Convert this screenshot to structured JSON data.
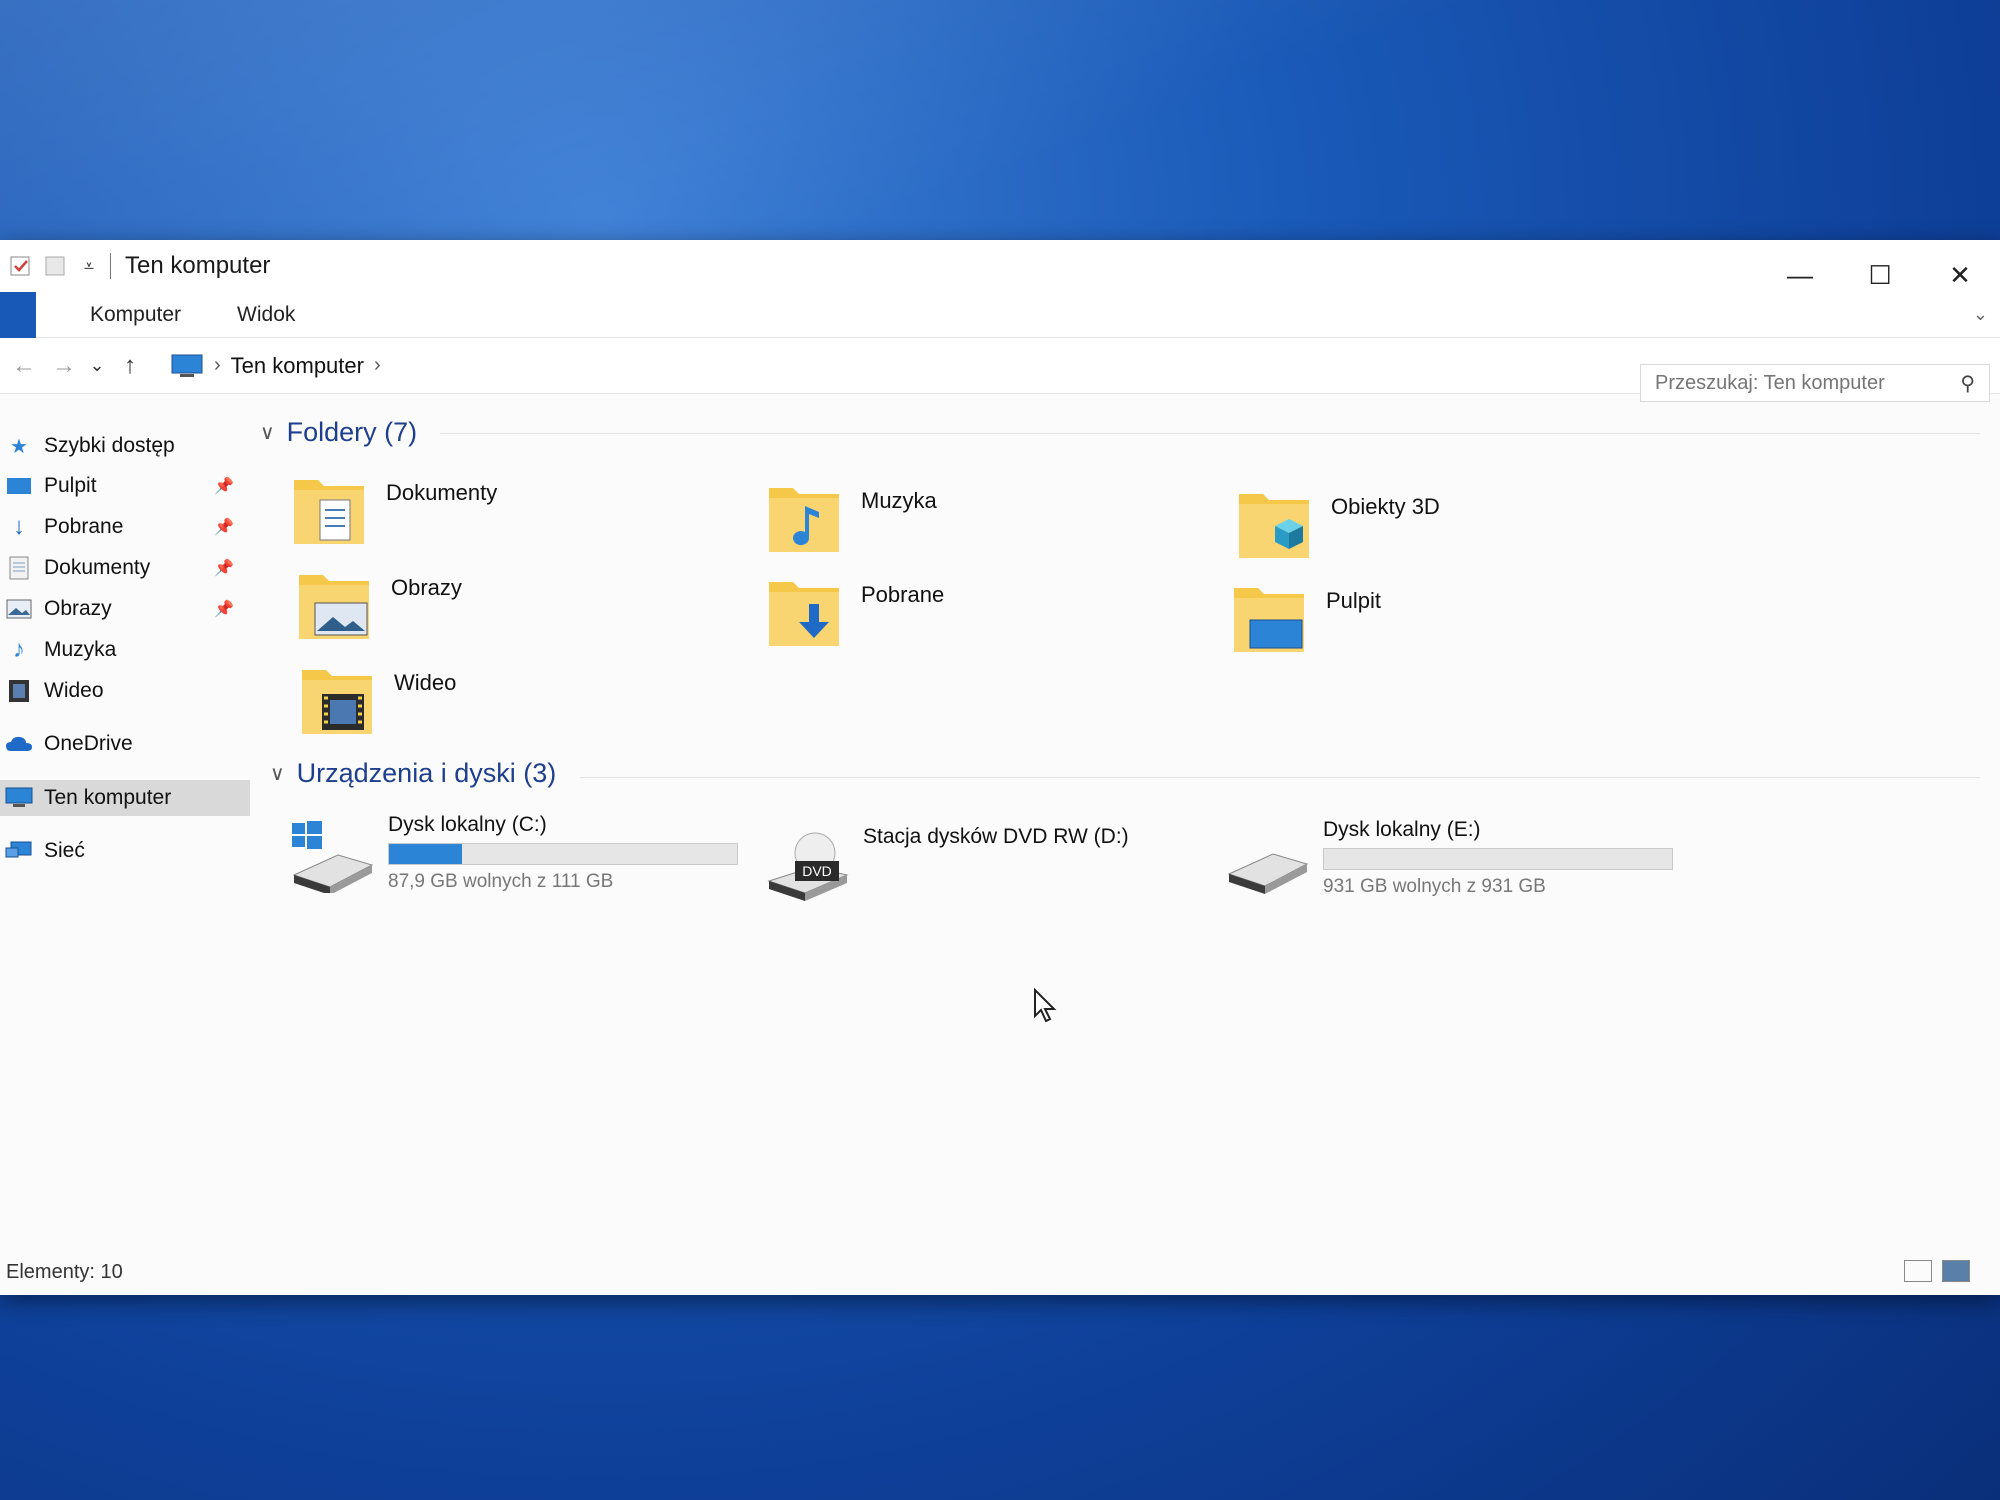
{
  "window": {
    "title": "Ten komputer",
    "controls": {
      "minimize": "—",
      "maximize": "☐",
      "close": "✕"
    }
  },
  "ribbon": {
    "tabs": [
      {
        "label": "Komputer"
      },
      {
        "label": "Widok"
      }
    ]
  },
  "address": {
    "breadcrumb": "Ten komputer",
    "search_placeholder": "Przeszukaj: Ten komputer"
  },
  "nav": {
    "quick_access": "Szybki dostęp",
    "items": [
      {
        "label": "Pulpit",
        "pinned": true
      },
      {
        "label": "Pobrane",
        "pinned": true
      },
      {
        "label": "Dokumenty",
        "pinned": true
      },
      {
        "label": "Obrazy",
        "pinned": true
      },
      {
        "label": "Muzyka",
        "pinned": false
      },
      {
        "label": "Wideo",
        "pinned": false
      }
    ],
    "onedrive": "OneDrive",
    "this_pc": "Ten komputer",
    "network": "Sieć"
  },
  "folders": {
    "header": "Foldery (7)",
    "items": [
      {
        "label": "Dokumenty",
        "icon": "documents-folder-icon"
      },
      {
        "label": "Muzyka",
        "icon": "music-folder-icon"
      },
      {
        "label": "Obiekty 3D",
        "icon": "3d-objects-folder-icon"
      },
      {
        "label": "Obrazy",
        "icon": "pictures-folder-icon"
      },
      {
        "label": "Pobrane",
        "icon": "downloads-folder-icon"
      },
      {
        "label": "Pulpit",
        "icon": "desktop-folder-icon"
      },
      {
        "label": "Wideo",
        "icon": "videos-folder-icon"
      }
    ]
  },
  "drives": {
    "header": "Urządzenia i dyski (3)",
    "items": [
      {
        "name": "Dysk lokalny (C:)",
        "free": "87,9 GB wolnych z 111 GB",
        "used_fraction": 0.21
      },
      {
        "name": "Stacja dysków DVD RW (D:)",
        "badge": "DVD"
      },
      {
        "name": "Dysk lokalny (E:)",
        "free": "931 GB wolnych z 931 GB",
        "used_fraction": 0.0
      }
    ]
  },
  "status": {
    "items_count": "Elementy: 10"
  },
  "colors": {
    "accent": "#1859b8",
    "group_header": "#1e3f8f",
    "drive_bar": "#2c84d7",
    "folder": "#f5c84a"
  }
}
